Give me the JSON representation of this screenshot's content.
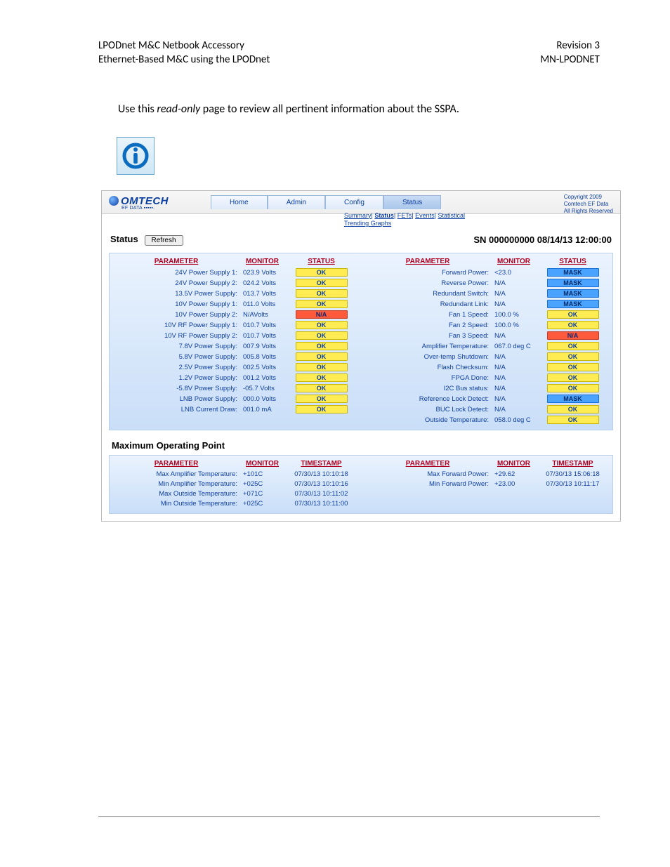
{
  "header": {
    "left1": "LPODnet M&C Netbook Accessory",
    "left2": "Ethernet-Based M&C using the LPODnet",
    "right1": "Revision 3",
    "right2": "MN-LPODNET"
  },
  "intro_pre": "Use this ",
  "intro_em": "read-only",
  "intro_post": " page to review all pertinent information about the SSPA.",
  "logo_sub": "EF DATA ▪▪▪▪▪.",
  "nav": {
    "home": "Home",
    "admin": "Admin",
    "config": "Config",
    "status": "Status"
  },
  "subnav": {
    "summary": "Summary",
    "status": "Status",
    "fets": "FETs",
    "events": "Events",
    "stats": "Statistical",
    "trend": "Trending Graphs"
  },
  "copyright": {
    "l1": "Copyright 2009",
    "l2": "Comtech EF Data",
    "l3": "All Rights Reserved"
  },
  "status_label": "Status",
  "refresh": "Refresh",
  "sn": "SN 000000000 08/14/13 12:00:00",
  "headers": {
    "param": "PARAMETER",
    "monitor": "MONITOR",
    "status": "STATUS",
    "timestamp": "TIMESTAMP"
  },
  "pills": {
    "ok": "OK",
    "mask": "MASK",
    "na": "N/A"
  },
  "left_rows": [
    {
      "p": "24V Power Supply 1:",
      "m": "023.9 Volts",
      "s": "ok"
    },
    {
      "p": "24V Power Supply 2:",
      "m": "024.2 Volts",
      "s": "ok"
    },
    {
      "p": "13.5V Power Supply:",
      "m": "013.7 Volts",
      "s": "ok"
    },
    {
      "p": "10V Power Supply 1:",
      "m": "011.0 Volts",
      "s": "ok"
    },
    {
      "p": "10V Power Supply 2:",
      "m": "N/AVolts",
      "s": "na"
    },
    {
      "p": "10V RF Power Supply 1:",
      "m": "010.7 Volts",
      "s": "ok"
    },
    {
      "p": "10V RF Power Supply 2:",
      "m": "010.7 Volts",
      "s": "ok"
    },
    {
      "p": "7.8V Power Supply:",
      "m": "007.9 Volts",
      "s": "ok"
    },
    {
      "p": "5.8V Power Supply:",
      "m": "005.8 Volts",
      "s": "ok"
    },
    {
      "p": "2.5V Power Supply:",
      "m": "002.5 Volts",
      "s": "ok"
    },
    {
      "p": "1.2V Power Supply:",
      "m": "001.2 Volts",
      "s": "ok"
    },
    {
      "p": "-5.8V Power Supply:",
      "m": "-05.7 Volts",
      "s": "ok"
    },
    {
      "p": "LNB Power Supply:",
      "m": "000.0 Volts",
      "s": "ok"
    },
    {
      "p": "LNB Current Draw:",
      "m": "001.0 mA",
      "s": "ok"
    }
  ],
  "right_rows": [
    {
      "p": "Forward Power:",
      "m": "<23.0",
      "s": "mask"
    },
    {
      "p": "Reverse Power:",
      "m": "N/A",
      "s": "mask"
    },
    {
      "p": "Redundant Switch:",
      "m": "N/A",
      "s": "mask"
    },
    {
      "p": "Redundant Link:",
      "m": "N/A",
      "s": "mask"
    },
    {
      "p": "Fan 1 Speed:",
      "m": "100.0 %",
      "s": "ok"
    },
    {
      "p": "Fan 2 Speed:",
      "m": "100.0 %",
      "s": "ok"
    },
    {
      "p": "Fan 3 Speed:",
      "m": "N/A",
      "s": "na"
    },
    {
      "p": "Amplifier Temperature:",
      "m": "067.0 deg C",
      "s": "ok"
    },
    {
      "p": "Over-temp Shutdown:",
      "m": "N/A",
      "s": "ok"
    },
    {
      "p": "Flash Checksum:",
      "m": "N/A",
      "s": "ok"
    },
    {
      "p": "FPGA Done:",
      "m": "N/A",
      "s": "ok"
    },
    {
      "p": "I2C Bus status:",
      "m": "N/A",
      "s": "ok"
    },
    {
      "p": "Reference Lock Detect:",
      "m": "N/A",
      "s": "mask"
    },
    {
      "p": "BUC Lock Detect:",
      "m": "N/A",
      "s": "ok"
    },
    {
      "p": "Outside Temperature:",
      "m": "058.0 deg C",
      "s": "ok"
    }
  ],
  "maxop_title": "Maximum Operating Point",
  "maxop_left": [
    {
      "p": "Max Amplifier Temperature:",
      "m": "+101C",
      "t": "07/30/13 10:10:18"
    },
    {
      "p": "Min Amplifier Temperature:",
      "m": "+025C",
      "t": "07/30/13 10:10:16"
    },
    {
      "p": "Max Outside Temperature:",
      "m": "+071C",
      "t": "07/30/13 10:11:02"
    },
    {
      "p": "Min Outside Temperature:",
      "m": "+025C",
      "t": "07/30/13 10:11:00"
    }
  ],
  "maxop_right": [
    {
      "p": "Max Forward Power:",
      "m": "+29.62",
      "t": "07/30/13 15:06:18"
    },
    {
      "p": "Min Forward Power:",
      "m": "+23.00",
      "t": "07/30/13 10:11:17"
    }
  ]
}
